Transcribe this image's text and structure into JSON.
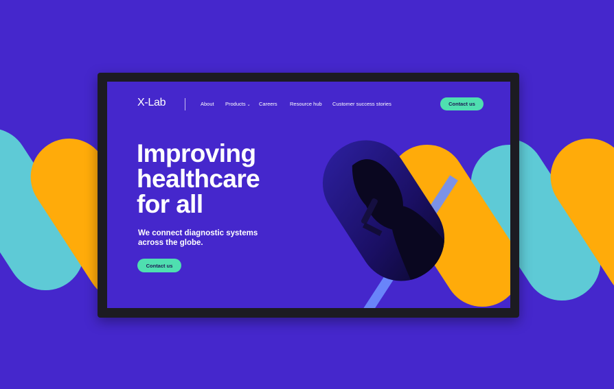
{
  "brand": {
    "logo_text": "X-Lab"
  },
  "nav": {
    "items": [
      "About",
      "Products",
      "Careers",
      "Resource hub",
      "Customer success stories"
    ],
    "contact_label": "Contact us"
  },
  "hero": {
    "title_lines": [
      "Improving",
      "healthcare",
      "for all"
    ],
    "subtitle_lines": [
      "We connect diagnostic systems",
      "across the globe."
    ],
    "cta_label": "Contact us"
  },
  "colors": {
    "background": "#4527cc",
    "accent_cyan": "#5ecad6",
    "accent_orange": "#ffab0a",
    "button_green": "#4fdfb0",
    "monitor_bezel": "#1c1b22"
  },
  "icons": {
    "products_chevron": "chevron-down-icon"
  }
}
